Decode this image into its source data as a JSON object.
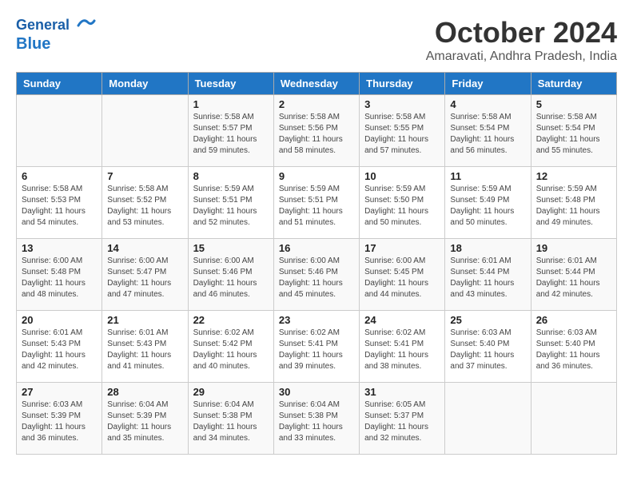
{
  "header": {
    "logo_line1": "General",
    "logo_line2": "Blue",
    "month_title": "October 2024",
    "location": "Amaravati, Andhra Pradesh, India"
  },
  "weekdays": [
    "Sunday",
    "Monday",
    "Tuesday",
    "Wednesday",
    "Thursday",
    "Friday",
    "Saturday"
  ],
  "weeks": [
    [
      {
        "day": "",
        "info": ""
      },
      {
        "day": "",
        "info": ""
      },
      {
        "day": "1",
        "info": "Sunrise: 5:58 AM\nSunset: 5:57 PM\nDaylight: 11 hours\nand 59 minutes."
      },
      {
        "day": "2",
        "info": "Sunrise: 5:58 AM\nSunset: 5:56 PM\nDaylight: 11 hours\nand 58 minutes."
      },
      {
        "day": "3",
        "info": "Sunrise: 5:58 AM\nSunset: 5:55 PM\nDaylight: 11 hours\nand 57 minutes."
      },
      {
        "day": "4",
        "info": "Sunrise: 5:58 AM\nSunset: 5:54 PM\nDaylight: 11 hours\nand 56 minutes."
      },
      {
        "day": "5",
        "info": "Sunrise: 5:58 AM\nSunset: 5:54 PM\nDaylight: 11 hours\nand 55 minutes."
      }
    ],
    [
      {
        "day": "6",
        "info": "Sunrise: 5:58 AM\nSunset: 5:53 PM\nDaylight: 11 hours\nand 54 minutes."
      },
      {
        "day": "7",
        "info": "Sunrise: 5:58 AM\nSunset: 5:52 PM\nDaylight: 11 hours\nand 53 minutes."
      },
      {
        "day": "8",
        "info": "Sunrise: 5:59 AM\nSunset: 5:51 PM\nDaylight: 11 hours\nand 52 minutes."
      },
      {
        "day": "9",
        "info": "Sunrise: 5:59 AM\nSunset: 5:51 PM\nDaylight: 11 hours\nand 51 minutes."
      },
      {
        "day": "10",
        "info": "Sunrise: 5:59 AM\nSunset: 5:50 PM\nDaylight: 11 hours\nand 50 minutes."
      },
      {
        "day": "11",
        "info": "Sunrise: 5:59 AM\nSunset: 5:49 PM\nDaylight: 11 hours\nand 50 minutes."
      },
      {
        "day": "12",
        "info": "Sunrise: 5:59 AM\nSunset: 5:48 PM\nDaylight: 11 hours\nand 49 minutes."
      }
    ],
    [
      {
        "day": "13",
        "info": "Sunrise: 6:00 AM\nSunset: 5:48 PM\nDaylight: 11 hours\nand 48 minutes."
      },
      {
        "day": "14",
        "info": "Sunrise: 6:00 AM\nSunset: 5:47 PM\nDaylight: 11 hours\nand 47 minutes."
      },
      {
        "day": "15",
        "info": "Sunrise: 6:00 AM\nSunset: 5:46 PM\nDaylight: 11 hours\nand 46 minutes."
      },
      {
        "day": "16",
        "info": "Sunrise: 6:00 AM\nSunset: 5:46 PM\nDaylight: 11 hours\nand 45 minutes."
      },
      {
        "day": "17",
        "info": "Sunrise: 6:00 AM\nSunset: 5:45 PM\nDaylight: 11 hours\nand 44 minutes."
      },
      {
        "day": "18",
        "info": "Sunrise: 6:01 AM\nSunset: 5:44 PM\nDaylight: 11 hours\nand 43 minutes."
      },
      {
        "day": "19",
        "info": "Sunrise: 6:01 AM\nSunset: 5:44 PM\nDaylight: 11 hours\nand 42 minutes."
      }
    ],
    [
      {
        "day": "20",
        "info": "Sunrise: 6:01 AM\nSunset: 5:43 PM\nDaylight: 11 hours\nand 42 minutes."
      },
      {
        "day": "21",
        "info": "Sunrise: 6:01 AM\nSunset: 5:43 PM\nDaylight: 11 hours\nand 41 minutes."
      },
      {
        "day": "22",
        "info": "Sunrise: 6:02 AM\nSunset: 5:42 PM\nDaylight: 11 hours\nand 40 minutes."
      },
      {
        "day": "23",
        "info": "Sunrise: 6:02 AM\nSunset: 5:41 PM\nDaylight: 11 hours\nand 39 minutes."
      },
      {
        "day": "24",
        "info": "Sunrise: 6:02 AM\nSunset: 5:41 PM\nDaylight: 11 hours\nand 38 minutes."
      },
      {
        "day": "25",
        "info": "Sunrise: 6:03 AM\nSunset: 5:40 PM\nDaylight: 11 hours\nand 37 minutes."
      },
      {
        "day": "26",
        "info": "Sunrise: 6:03 AM\nSunset: 5:40 PM\nDaylight: 11 hours\nand 36 minutes."
      }
    ],
    [
      {
        "day": "27",
        "info": "Sunrise: 6:03 AM\nSunset: 5:39 PM\nDaylight: 11 hours\nand 36 minutes."
      },
      {
        "day": "28",
        "info": "Sunrise: 6:04 AM\nSunset: 5:39 PM\nDaylight: 11 hours\nand 35 minutes."
      },
      {
        "day": "29",
        "info": "Sunrise: 6:04 AM\nSunset: 5:38 PM\nDaylight: 11 hours\nand 34 minutes."
      },
      {
        "day": "30",
        "info": "Sunrise: 6:04 AM\nSunset: 5:38 PM\nDaylight: 11 hours\nand 33 minutes."
      },
      {
        "day": "31",
        "info": "Sunrise: 6:05 AM\nSunset: 5:37 PM\nDaylight: 11 hours\nand 32 minutes."
      },
      {
        "day": "",
        "info": ""
      },
      {
        "day": "",
        "info": ""
      }
    ]
  ]
}
